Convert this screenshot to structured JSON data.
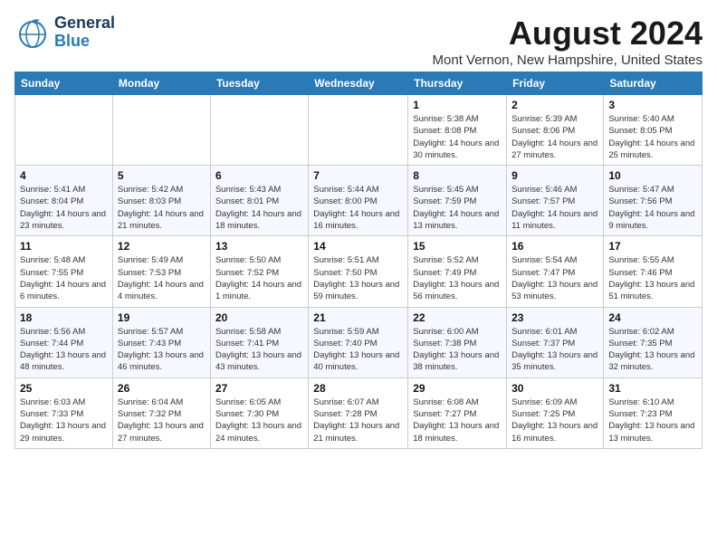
{
  "header": {
    "logo_general": "General",
    "logo_blue": "Blue",
    "month_title": "August 2024",
    "subtitle": "Mont Vernon, New Hampshire, United States"
  },
  "days_of_week": [
    "Sunday",
    "Monday",
    "Tuesday",
    "Wednesday",
    "Thursday",
    "Friday",
    "Saturday"
  ],
  "weeks": [
    [
      {
        "day": "",
        "info": ""
      },
      {
        "day": "",
        "info": ""
      },
      {
        "day": "",
        "info": ""
      },
      {
        "day": "",
        "info": ""
      },
      {
        "day": "1",
        "info": "Sunrise: 5:38 AM\nSunset: 8:08 PM\nDaylight: 14 hours and 30 minutes."
      },
      {
        "day": "2",
        "info": "Sunrise: 5:39 AM\nSunset: 8:06 PM\nDaylight: 14 hours and 27 minutes."
      },
      {
        "day": "3",
        "info": "Sunrise: 5:40 AM\nSunset: 8:05 PM\nDaylight: 14 hours and 25 minutes."
      }
    ],
    [
      {
        "day": "4",
        "info": "Sunrise: 5:41 AM\nSunset: 8:04 PM\nDaylight: 14 hours and 23 minutes."
      },
      {
        "day": "5",
        "info": "Sunrise: 5:42 AM\nSunset: 8:03 PM\nDaylight: 14 hours and 21 minutes."
      },
      {
        "day": "6",
        "info": "Sunrise: 5:43 AM\nSunset: 8:01 PM\nDaylight: 14 hours and 18 minutes."
      },
      {
        "day": "7",
        "info": "Sunrise: 5:44 AM\nSunset: 8:00 PM\nDaylight: 14 hours and 16 minutes."
      },
      {
        "day": "8",
        "info": "Sunrise: 5:45 AM\nSunset: 7:59 PM\nDaylight: 14 hours and 13 minutes."
      },
      {
        "day": "9",
        "info": "Sunrise: 5:46 AM\nSunset: 7:57 PM\nDaylight: 14 hours and 11 minutes."
      },
      {
        "day": "10",
        "info": "Sunrise: 5:47 AM\nSunset: 7:56 PM\nDaylight: 14 hours and 9 minutes."
      }
    ],
    [
      {
        "day": "11",
        "info": "Sunrise: 5:48 AM\nSunset: 7:55 PM\nDaylight: 14 hours and 6 minutes."
      },
      {
        "day": "12",
        "info": "Sunrise: 5:49 AM\nSunset: 7:53 PM\nDaylight: 14 hours and 4 minutes."
      },
      {
        "day": "13",
        "info": "Sunrise: 5:50 AM\nSunset: 7:52 PM\nDaylight: 14 hours and 1 minute."
      },
      {
        "day": "14",
        "info": "Sunrise: 5:51 AM\nSunset: 7:50 PM\nDaylight: 13 hours and 59 minutes."
      },
      {
        "day": "15",
        "info": "Sunrise: 5:52 AM\nSunset: 7:49 PM\nDaylight: 13 hours and 56 minutes."
      },
      {
        "day": "16",
        "info": "Sunrise: 5:54 AM\nSunset: 7:47 PM\nDaylight: 13 hours and 53 minutes."
      },
      {
        "day": "17",
        "info": "Sunrise: 5:55 AM\nSunset: 7:46 PM\nDaylight: 13 hours and 51 minutes."
      }
    ],
    [
      {
        "day": "18",
        "info": "Sunrise: 5:56 AM\nSunset: 7:44 PM\nDaylight: 13 hours and 48 minutes."
      },
      {
        "day": "19",
        "info": "Sunrise: 5:57 AM\nSunset: 7:43 PM\nDaylight: 13 hours and 46 minutes."
      },
      {
        "day": "20",
        "info": "Sunrise: 5:58 AM\nSunset: 7:41 PM\nDaylight: 13 hours and 43 minutes."
      },
      {
        "day": "21",
        "info": "Sunrise: 5:59 AM\nSunset: 7:40 PM\nDaylight: 13 hours and 40 minutes."
      },
      {
        "day": "22",
        "info": "Sunrise: 6:00 AM\nSunset: 7:38 PM\nDaylight: 13 hours and 38 minutes."
      },
      {
        "day": "23",
        "info": "Sunrise: 6:01 AM\nSunset: 7:37 PM\nDaylight: 13 hours and 35 minutes."
      },
      {
        "day": "24",
        "info": "Sunrise: 6:02 AM\nSunset: 7:35 PM\nDaylight: 13 hours and 32 minutes."
      }
    ],
    [
      {
        "day": "25",
        "info": "Sunrise: 6:03 AM\nSunset: 7:33 PM\nDaylight: 13 hours and 29 minutes."
      },
      {
        "day": "26",
        "info": "Sunrise: 6:04 AM\nSunset: 7:32 PM\nDaylight: 13 hours and 27 minutes."
      },
      {
        "day": "27",
        "info": "Sunrise: 6:05 AM\nSunset: 7:30 PM\nDaylight: 13 hours and 24 minutes."
      },
      {
        "day": "28",
        "info": "Sunrise: 6:07 AM\nSunset: 7:28 PM\nDaylight: 13 hours and 21 minutes."
      },
      {
        "day": "29",
        "info": "Sunrise: 6:08 AM\nSunset: 7:27 PM\nDaylight: 13 hours and 18 minutes."
      },
      {
        "day": "30",
        "info": "Sunrise: 6:09 AM\nSunset: 7:25 PM\nDaylight: 13 hours and 16 minutes."
      },
      {
        "day": "31",
        "info": "Sunrise: 6:10 AM\nSunset: 7:23 PM\nDaylight: 13 hours and 13 minutes."
      }
    ]
  ]
}
